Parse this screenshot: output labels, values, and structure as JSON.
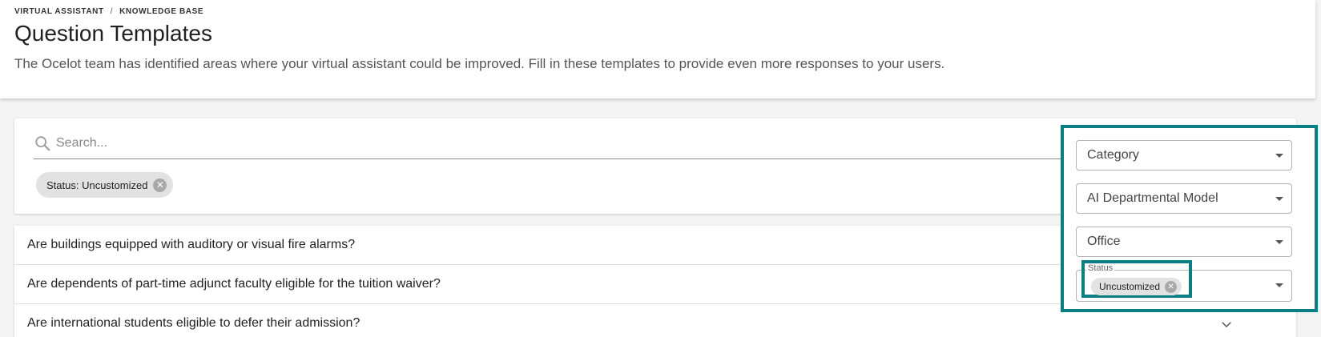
{
  "breadcrumb": {
    "items": [
      "VIRTUAL ASSISTANT",
      "KNOWLEDGE BASE"
    ],
    "separator": "/"
  },
  "header": {
    "title": "Question Templates",
    "description": "The Ocelot team has identified areas where your virtual assistant could be improved. Fill in these templates to provide even more responses to your users."
  },
  "search": {
    "placeholder": "Search...",
    "value": ""
  },
  "active_filter_chip": {
    "label": "Status: Uncustomized",
    "remove_icon": "close-circle-icon"
  },
  "questions": [
    "Are buildings equipped with auditory or visual fire alarms?",
    "Are dependents of part-time adjunct faculty eligible for the tuition waiver?",
    "Are international students eligible to defer their admission?"
  ],
  "filters": {
    "category": {
      "value": "Category"
    },
    "model": {
      "value": "AI Departmental Model"
    },
    "office": {
      "value": "Office"
    },
    "status": {
      "label": "Status",
      "selected": "Uncustomized"
    }
  },
  "colors": {
    "highlight": "#0a7e82",
    "chip_bg": "#e2e2e2"
  }
}
